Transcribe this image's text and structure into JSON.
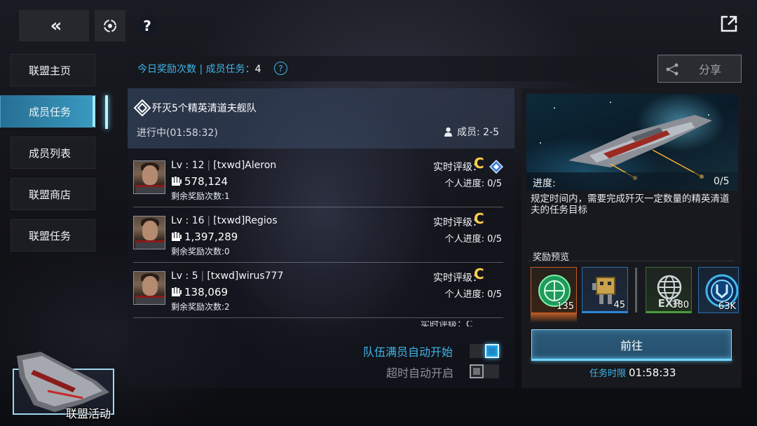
{
  "sidebar": {
    "items": [
      {
        "label": "联盟主页"
      },
      {
        "label": "成员任务"
      },
      {
        "label": "成员列表"
      },
      {
        "label": "联盟商店"
      },
      {
        "label": "联盟任务"
      }
    ],
    "active_index": 1
  },
  "header": {
    "reward_prefix": "今日奖励次数 | 成员任务：",
    "reward_count": "4",
    "share_label": "分享"
  },
  "mission": {
    "title": "歼灭5个精英清道夫舰队",
    "status": "进行中(01:58:32)",
    "member_label": "成员: 2-5",
    "members": [
      {
        "level": "Lv : 12",
        "name": "[txwd]Aleron",
        "power": "578,124",
        "remain": "剩余奖励次数:1",
        "grade_label": "实时评级：",
        "grade": "C",
        "progress": "个人进度: 0/5",
        "has_rank_icon": true
      },
      {
        "level": "Lv : 16",
        "name": "[txwd]Regios",
        "power": "1,397,289",
        "remain": "剩余奖励次数:0",
        "grade_label": "实时评级：",
        "grade": "C",
        "progress": "个人进度: 0/5",
        "has_rank_icon": false
      },
      {
        "level": "Lv : 5",
        "name": "[txwd]wirus777",
        "power": "138,069",
        "remain": "剩余奖励次数:2",
        "grade_label": "实时评级：",
        "grade": "C",
        "progress": "个人进度: 0/5",
        "has_rank_icon": false
      }
    ],
    "cut_row_text": "实时评级：C"
  },
  "toggles": {
    "auto_full_label": "队伍满员自动开始",
    "auto_full_on": true,
    "auto_timeout_label": "超时自动开启",
    "auto_timeout_on": false
  },
  "detail": {
    "progress_label": "进度:",
    "progress_value": "0/5",
    "progress_fraction": 0,
    "description": "规定时间内，需要完成歼灭一定数量的精英清道夫的任务目标",
    "reward_preview_label": "奖励预览",
    "rewards": [
      {
        "icon": "alliance-contribution-icon",
        "count": "135"
      },
      {
        "icon": "robot-parts-icon",
        "count": "45"
      },
      {
        "icon": "exp-globe-icon",
        "count": "380"
      },
      {
        "icon": "blue-emblem-icon",
        "count": "63K"
      }
    ],
    "go_label": "前往",
    "time_limit_label": "任务时限",
    "time_limit_value": "01:58:33"
  },
  "event": {
    "label": "联盟活动"
  },
  "colors": {
    "accent": "#3fb6ea",
    "grade": "#ffcf4a",
    "active_tab": "#3ca0c8"
  }
}
